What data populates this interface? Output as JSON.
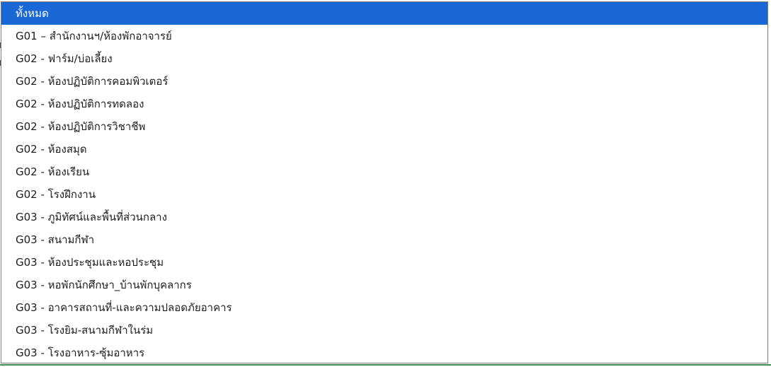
{
  "dropdown": {
    "selected_index": 0,
    "options": [
      "ทั้งหมด",
      "G01 – สำนักงานฯ/ห้องพักอาจารย์",
      "G02 - ฟาร์ม/บ่อเลี้ยง",
      "G02 - ห้องปฏิบัติการคอมพิวเตอร์",
      "G02 - ห้องปฏิบัติการทดลอง",
      "G02 - ห้องปฏิบัติการวิชาชีพ",
      "G02 - ห้องสมุด",
      "G02 - ห้องเรียน",
      "G02 - โรงฝึกงาน",
      "G03 - ภูมิทัศน์และพื้นที่ส่วนกลาง",
      "G03 - สนามกีฬา",
      "G03 - ห้องประชุมและหอประชุม",
      "G03 - หอพักนักศึกษา_บ้านพักบุคลากร",
      "G03 - อาคารสถานที่-และความปลอดภัยอาคาร",
      "G03 - โรงยิม-สนามกีฬาในร่ม",
      "G03 - โรงอาหาร-ซุ้มอาหาร"
    ]
  },
  "colors": {
    "selected_bg": "#1a67d6",
    "selected_fg": "#ffffff",
    "text": "#1e1e1e",
    "border": "#7a7a7a"
  }
}
